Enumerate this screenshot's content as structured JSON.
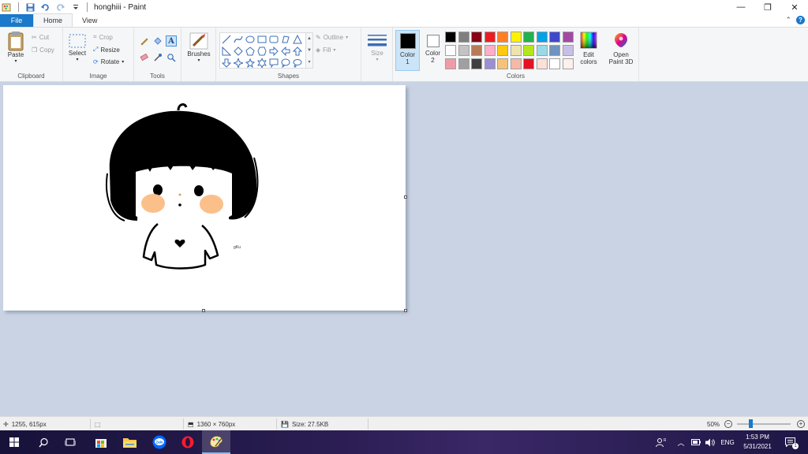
{
  "window": {
    "title": "honghiii - Paint",
    "minimize_glyph": "—",
    "restore_glyph": "❐",
    "close_glyph": "✕"
  },
  "tabs": {
    "file": "File",
    "home": "Home",
    "view": "View",
    "collapse_glyph": "⌃",
    "help_glyph": "?"
  },
  "ribbon": {
    "clipboard": {
      "label": "Clipboard",
      "paste": "Paste",
      "cut": "Cut",
      "copy": "Copy"
    },
    "image": {
      "label": "Image",
      "select": "Select",
      "crop": "Crop",
      "resize": "Resize",
      "rotate": "Rotate"
    },
    "tools": {
      "label": "Tools"
    },
    "brushes": {
      "label": "Brushes"
    },
    "shapes": {
      "label": "Shapes",
      "outline": "Outline",
      "fill": "Fill"
    },
    "size": {
      "label": "Size"
    },
    "colors": {
      "label": "Colors",
      "color1": "Color 1",
      "color2": "Color 2",
      "color1_value": "#000000",
      "color2_value": "#ffffff",
      "edit": "Edit colors",
      "paint3d": "Open Paint 3D",
      "palette": [
        "#000000",
        "#7f7f7f",
        "#880015",
        "#ed1c24",
        "#ff7f27",
        "#fff200",
        "#22b14c",
        "#00a2e8",
        "#3f48cc",
        "#a349a4",
        "#ffffff",
        "#c3c3c3",
        "#b97a57",
        "#ffaec9",
        "#ffc90e",
        "#efe4b0",
        "#b5e61d",
        "#99d9ea",
        "#7092be",
        "#c8bfe7",
        "#f09ca8",
        "#a0a0a0",
        "#404040",
        "#9b8fd6",
        "#f6c27a",
        "#f6b9a8",
        "#e81123",
        "#fde0d8",
        "#ffffff",
        "#fdf0ee"
      ]
    }
  },
  "canvas": {
    "signature": "gKu"
  },
  "status": {
    "cursor": "1255, 615px",
    "dimensions": "1360 × 760px",
    "size": "Size: 27.5KB",
    "zoom": "50%",
    "zoom_level": 0.5
  },
  "taskbar": {
    "lang": "ENG",
    "time": "1:53 PM",
    "date": "5/31/2021",
    "apps": [
      "start",
      "search",
      "task-view",
      "store",
      "file-explorer",
      "zalo",
      "opera",
      "paint"
    ]
  }
}
